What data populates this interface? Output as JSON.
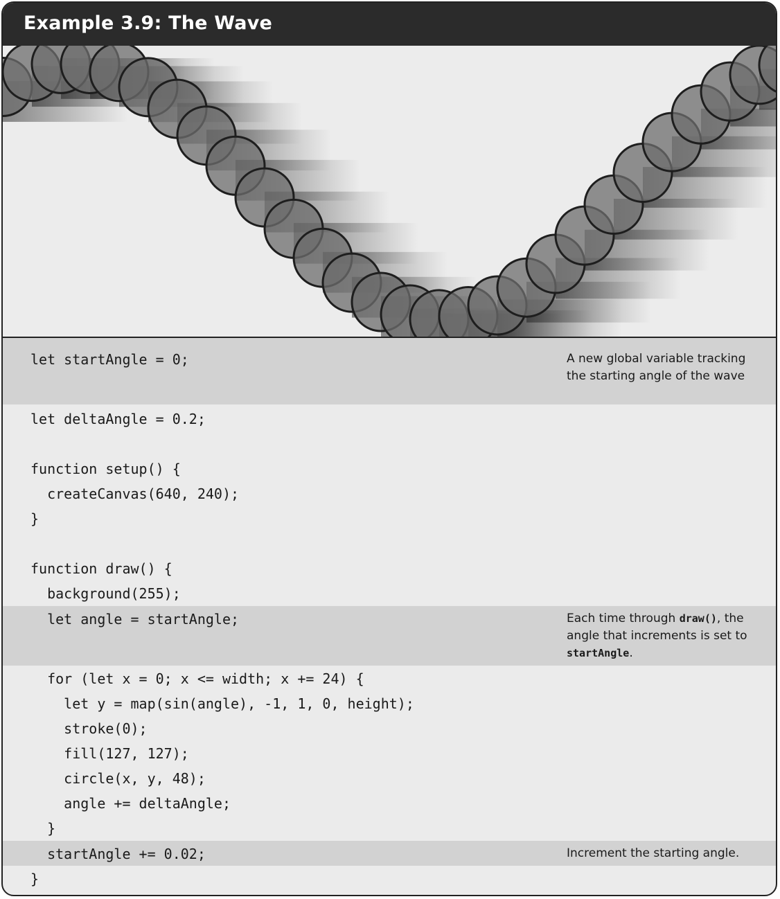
{
  "example_title": "Example 3.9: The Wave",
  "canvas": {
    "circle_diameter": 48,
    "stroke_color": "#1e1e1e",
    "fill_color": "#6e6e6e",
    "background_color": "#ececec"
  },
  "code": {
    "lines": [
      "let startAngle = 0;",
      "let deltaAngle = 0.2;",
      "",
      "function setup() {",
      "  createCanvas(640, 240);",
      "}",
      "",
      "function draw() {",
      "  background(255);",
      "  let angle = startAngle;",
      "  for (let x = 0; x <= width; x += 24) {",
      "    let y = map(sin(angle), -1, 1, 0, height);",
      "    stroke(0);",
      "    fill(127, 127);",
      "    circle(x, y, 48);",
      "    angle += deltaAngle;",
      "  }",
      "  startAngle += 0.02;",
      "}"
    ]
  },
  "notes": {
    "n1": "A new global variable tracking the starting angle of the wave",
    "n2_pre": "Each time through ",
    "n2_code1": "draw()",
    "n2_mid": ", the angle that increments is set to ",
    "n2_code2": "startAngle",
    "n2_post": ".",
    "n3": "Increment the starting angle."
  }
}
